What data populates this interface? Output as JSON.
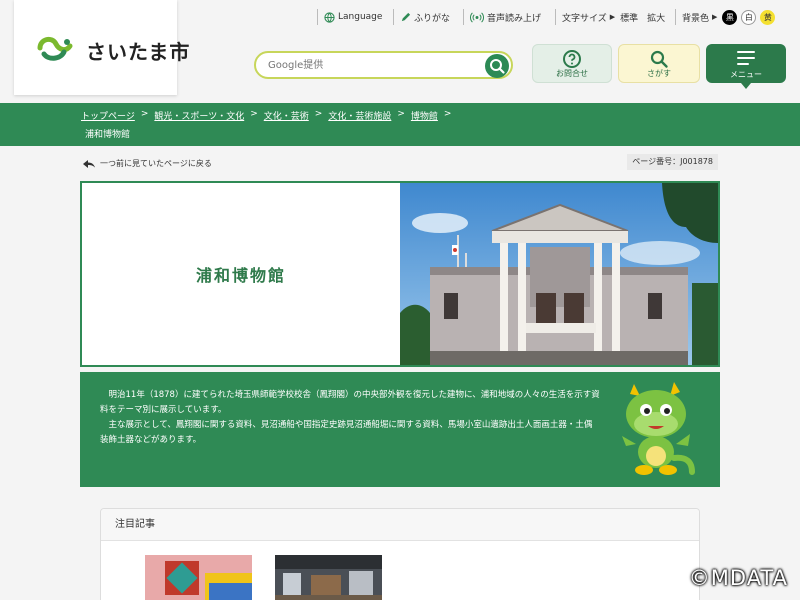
{
  "topbar": {
    "language": "Language",
    "furigana": "ふりがな",
    "read_aloud": "音声読み上げ",
    "font_size_label": "文字サイズ",
    "font_standard": "標準",
    "font_large": "拡大",
    "bg_color_label": "背景色",
    "bg_black": "黒",
    "bg_white": "白",
    "bg_yellow": "黄"
  },
  "header": {
    "logo_text": "さいたま市",
    "search_placeholder": "Google提供",
    "contact_label": "お問合せ",
    "find_label": "さがす",
    "menu_label": "メニュー"
  },
  "breadcrumb": {
    "items": [
      "トップページ",
      "観光・スポーツ・文化",
      "文化・芸術",
      "文化・芸術施設",
      "博物館"
    ],
    "separator": ">",
    "current": "浦和博物館"
  },
  "page": {
    "back_link": "一つ前に見ていたページに戻る",
    "page_number": "ページ番号：J001878",
    "title": "浦和博物館",
    "description": [
      "明治11年（1878）に建てられた埼玉県師範学校校舎（鳳翔閣）の中央部外観を復元した建物に、浦和地域の人々の生活を示す資料をテーマ別に展示しています。",
      "主な展示として、鳳翔閣に関する資料、見沼通船や国指定史跡見沼通船堀に関する資料、馬場小室山遺跡出土人面画土器・土偶装飾土器などがあります。"
    ],
    "featured_heading": "注目記事"
  },
  "copyright": "©MDATA",
  "colors": {
    "brand_green": "#2f8a55",
    "search_border": "#c7d65a",
    "find_bg": "#fbf6d2"
  }
}
